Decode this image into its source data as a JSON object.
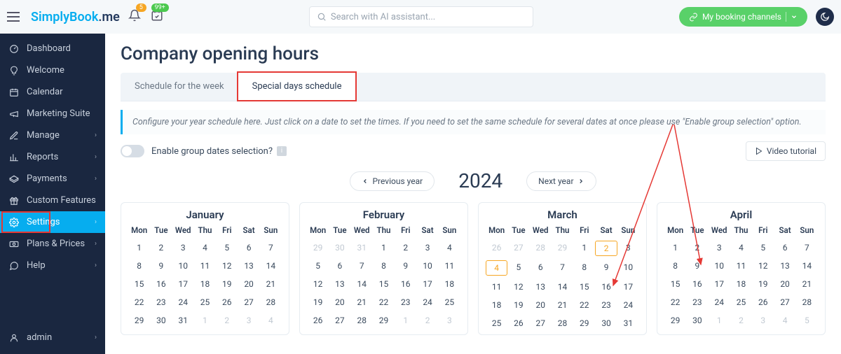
{
  "header": {
    "logo_a": "SimplyBook",
    "logo_b": ".me",
    "badge_bell": "5",
    "badge_cal": "99+",
    "search_placeholder": "Search with AI assistant...",
    "booking_btn": "My booking channels"
  },
  "sidebar": {
    "items": [
      {
        "label": "Dashboard",
        "icon": "dashboard",
        "chev": false
      },
      {
        "label": "Welcome",
        "icon": "bulb",
        "chev": false
      },
      {
        "label": "Calendar",
        "icon": "calendar",
        "chev": false
      },
      {
        "label": "Marketing Suite",
        "icon": "megaphone",
        "chev": false
      },
      {
        "label": "Manage",
        "icon": "pencil",
        "chev": true
      },
      {
        "label": "Reports",
        "icon": "reports",
        "chev": true
      },
      {
        "label": "Payments",
        "icon": "payments",
        "chev": true
      },
      {
        "label": "Custom Features",
        "icon": "gift",
        "chev": false
      },
      {
        "label": "Settings",
        "icon": "gear",
        "chev": true,
        "active": true,
        "boxed": true
      },
      {
        "label": "Plans & Prices",
        "icon": "price",
        "chev": true
      },
      {
        "label": "Help",
        "icon": "help",
        "chev": true
      },
      {
        "label": "admin",
        "icon": "user",
        "chev": true
      }
    ]
  },
  "main": {
    "title": "Company opening hours",
    "tabs": [
      {
        "label": "Schedule for the week",
        "active": false
      },
      {
        "label": "Special days schedule",
        "active": true,
        "boxed": true
      }
    ],
    "info": "Configure your year schedule here. Just click on a date to set the times. If you need to set the same schedule for several dates at once please use \"Enable group selection\" option.",
    "toggle_label": "Enable group dates selection?",
    "video_label": "Video tutorial",
    "prev_year": "Previous year",
    "next_year": "Next year",
    "year": "2024",
    "dow": [
      "Mon",
      "Tue",
      "Wed",
      "Thu",
      "Fri",
      "Sat",
      "Sun"
    ],
    "months": [
      {
        "name": "January",
        "days": [
          {
            "n": 1
          },
          {
            "n": 2
          },
          {
            "n": 3
          },
          {
            "n": 4
          },
          {
            "n": 5
          },
          {
            "n": 6
          },
          {
            "n": 7
          },
          {
            "n": 8
          },
          {
            "n": 9
          },
          {
            "n": 10
          },
          {
            "n": 11
          },
          {
            "n": 12
          },
          {
            "n": 13
          },
          {
            "n": 14
          },
          {
            "n": 15
          },
          {
            "n": 16
          },
          {
            "n": 17
          },
          {
            "n": 18
          },
          {
            "n": 19
          },
          {
            "n": 20
          },
          {
            "n": 21
          },
          {
            "n": 22
          },
          {
            "n": 23
          },
          {
            "n": 24
          },
          {
            "n": 25
          },
          {
            "n": 26
          },
          {
            "n": 27
          },
          {
            "n": 28
          },
          {
            "n": 29
          },
          {
            "n": 30
          },
          {
            "n": 31
          },
          {
            "n": 1,
            "m": true
          },
          {
            "n": 2,
            "m": true
          },
          {
            "n": 3,
            "m": true
          },
          {
            "n": 4,
            "m": true
          }
        ]
      },
      {
        "name": "February",
        "days": [
          {
            "n": 29,
            "m": true
          },
          {
            "n": 30,
            "m": true
          },
          {
            "n": 31,
            "m": true
          },
          {
            "n": 1
          },
          {
            "n": 2
          },
          {
            "n": 3
          },
          {
            "n": 4
          },
          {
            "n": 5
          },
          {
            "n": 6
          },
          {
            "n": 7
          },
          {
            "n": 8
          },
          {
            "n": 9
          },
          {
            "n": 10
          },
          {
            "n": 11
          },
          {
            "n": 12
          },
          {
            "n": 13
          },
          {
            "n": 14
          },
          {
            "n": 15
          },
          {
            "n": 16
          },
          {
            "n": 17
          },
          {
            "n": 18
          },
          {
            "n": 19
          },
          {
            "n": 20
          },
          {
            "n": 21
          },
          {
            "n": 22
          },
          {
            "n": 23
          },
          {
            "n": 24
          },
          {
            "n": 25
          },
          {
            "n": 26
          },
          {
            "n": 27
          },
          {
            "n": 28
          },
          {
            "n": 29
          },
          {
            "n": 1,
            "m": true
          },
          {
            "n": 2,
            "m": true
          },
          {
            "n": 3,
            "m": true
          }
        ]
      },
      {
        "name": "March",
        "days": [
          {
            "n": 26,
            "m": true
          },
          {
            "n": 27,
            "m": true
          },
          {
            "n": 28,
            "m": true
          },
          {
            "n": 29,
            "m": true
          },
          {
            "n": 1
          },
          {
            "n": 2,
            "hl": true
          },
          {
            "n": 3
          },
          {
            "n": 4,
            "hl": true
          },
          {
            "n": 5
          },
          {
            "n": 6
          },
          {
            "n": 7
          },
          {
            "n": 8
          },
          {
            "n": 9
          },
          {
            "n": 10
          },
          {
            "n": 11
          },
          {
            "n": 12
          },
          {
            "n": 13
          },
          {
            "n": 14
          },
          {
            "n": 15
          },
          {
            "n": 16
          },
          {
            "n": 17
          },
          {
            "n": 18
          },
          {
            "n": 19
          },
          {
            "n": 20
          },
          {
            "n": 21
          },
          {
            "n": 22
          },
          {
            "n": 23
          },
          {
            "n": 24
          },
          {
            "n": 25
          },
          {
            "n": 26
          },
          {
            "n": 27
          },
          {
            "n": 28
          },
          {
            "n": 29
          },
          {
            "n": 30
          },
          {
            "n": 31
          }
        ]
      },
      {
        "name": "April",
        "days": [
          {
            "n": 1
          },
          {
            "n": 2
          },
          {
            "n": 3
          },
          {
            "n": 4
          },
          {
            "n": 5
          },
          {
            "n": 6
          },
          {
            "n": 7
          },
          {
            "n": 8
          },
          {
            "n": 9
          },
          {
            "n": 10
          },
          {
            "n": 11
          },
          {
            "n": 12
          },
          {
            "n": 13
          },
          {
            "n": 14
          },
          {
            "n": 15
          },
          {
            "n": 16
          },
          {
            "n": 17
          },
          {
            "n": 18
          },
          {
            "n": 19
          },
          {
            "n": 20
          },
          {
            "n": 21
          },
          {
            "n": 22
          },
          {
            "n": 23
          },
          {
            "n": 24
          },
          {
            "n": 25
          },
          {
            "n": 26
          },
          {
            "n": 27
          },
          {
            "n": 28
          },
          {
            "n": 29
          },
          {
            "n": 30
          },
          {
            "n": 1,
            "m": true
          },
          {
            "n": 2,
            "m": true
          },
          {
            "n": 3,
            "m": true
          },
          {
            "n": 4,
            "m": true
          },
          {
            "n": 5,
            "m": true
          }
        ]
      }
    ]
  }
}
